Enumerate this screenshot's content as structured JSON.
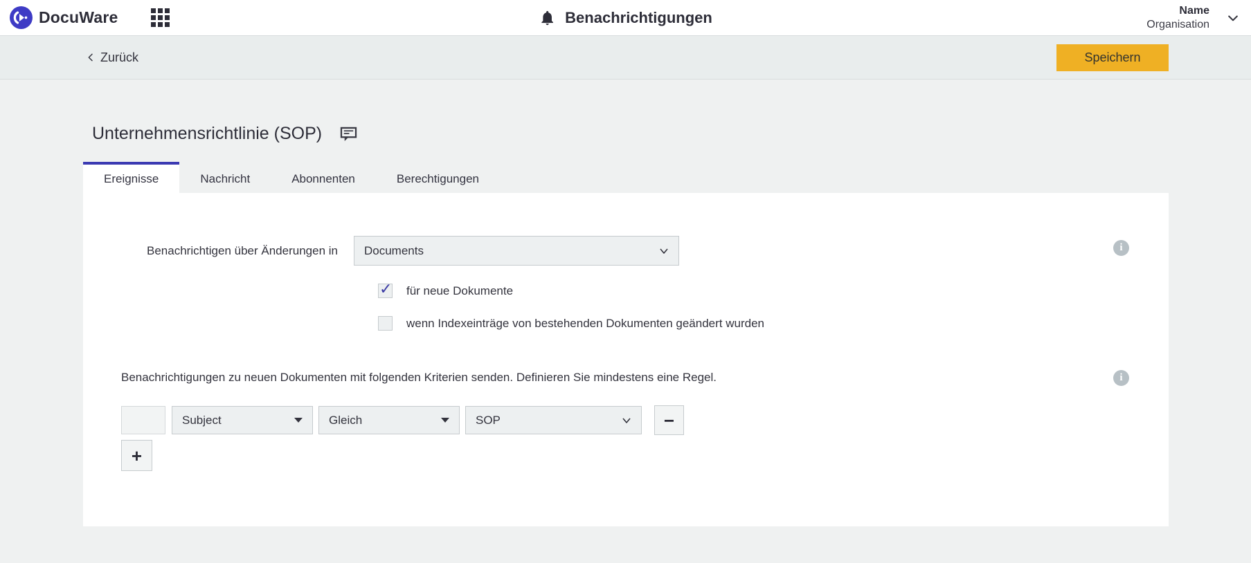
{
  "header": {
    "brand": "DocuWare",
    "title": "Benachrichtigungen",
    "user": {
      "name": "Name",
      "org": "Organisation"
    }
  },
  "toolbar": {
    "back_label": "Zurück",
    "save_label": "Speichern"
  },
  "page": {
    "title": "Unternehmensrichtlinie (SOP)",
    "tabs": [
      {
        "label": "Ereignisse",
        "active": true
      },
      {
        "label": "Nachricht",
        "active": false
      },
      {
        "label": "Abonnenten",
        "active": false
      },
      {
        "label": "Berechtigungen",
        "active": false
      }
    ]
  },
  "form": {
    "watch_label": "Benachrichtigen über Änderungen in",
    "watch_select_value": "Documents",
    "checkbox_new_documents": {
      "label": "für neue Dokumente",
      "checked": true
    },
    "checkbox_index_changed": {
      "label": "wenn Indexeinträge von bestehenden Dokumenten geändert wurden",
      "checked": false
    },
    "criteria_text": "Benachrichtigungen zu neuen Dokumenten mit folgenden Kriterien senden. Definieren Sie mindestens eine Regel.",
    "rule": {
      "field": "Subject",
      "operator": "Gleich",
      "value": "SOP"
    },
    "remove_rule_glyph": "−",
    "add_rule_glyph": "+"
  },
  "colors": {
    "accent_indigo": "#3b3ab2",
    "save_yellow": "#efb024",
    "page_bg": "#eff1f1",
    "toolbar_bg": "#e9eded",
    "input_bg": "#edf0f1",
    "input_border": "#c6cbce",
    "info_gray": "#b7c0c5",
    "text_dark": "#2d2d38"
  }
}
